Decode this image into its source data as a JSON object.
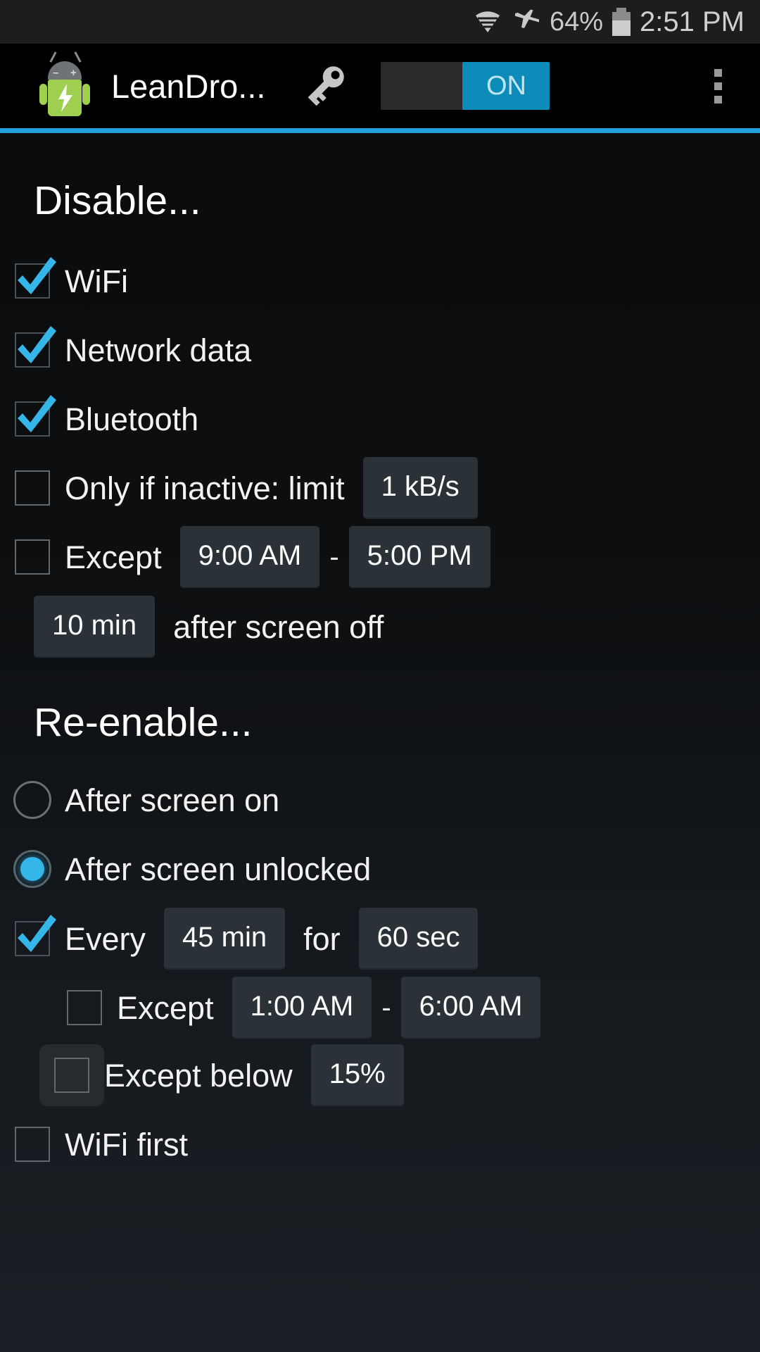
{
  "status_bar": {
    "wifi_icon": "wifi-icon",
    "airplane_icon": "airplane-mode-icon",
    "battery_percent": "64%",
    "battery_icon": "battery-icon",
    "time": "2:51 PM"
  },
  "action_bar": {
    "app_icon": "leandroid-app-icon",
    "title": "LeanDro...",
    "key_icon": "key-icon",
    "toggle_label": "ON",
    "toggle_state": "on",
    "overflow_icon": "overflow-menu-icon",
    "accent_color": "#1ea0d8"
  },
  "disable_section": {
    "title": "Disable...",
    "wifi": {
      "label": "WiFi",
      "checked": true
    },
    "network_data": {
      "label": "Network data",
      "checked": true
    },
    "bluetooth": {
      "label": "Bluetooth",
      "checked": true
    },
    "only_if_inactive": {
      "label": "Only if inactive: limit",
      "checked": false,
      "limit_value": "1 kB/s"
    },
    "except": {
      "label": "Except",
      "checked": false,
      "from": "9:00 AM",
      "separator": "-",
      "to": "5:00 PM"
    },
    "delay": {
      "value": "10 min",
      "label": "after screen off"
    }
  },
  "reenable_section": {
    "title": "Re-enable...",
    "after_screen_on": {
      "label": "After screen on",
      "selected": false
    },
    "after_screen_unlocked": {
      "label": "After screen unlocked",
      "selected": true
    },
    "every": {
      "label": "Every",
      "checked": true,
      "interval": "45 min",
      "for_label": "for",
      "duration": "60 sec"
    },
    "every_except": {
      "label": "Except",
      "checked": false,
      "from": "1:00 AM",
      "separator": "-",
      "to": "6:00 AM"
    },
    "except_below": {
      "label": "Except below",
      "checked": false,
      "highlighted": true,
      "threshold": "15%"
    },
    "wifi_first": {
      "label": "WiFi first",
      "checked": false
    }
  },
  "colors": {
    "accent": "#1ea0d8",
    "check": "#35b6e8",
    "pill_bg": "#2a3238",
    "toggle_on": "#0d8cb9"
  }
}
